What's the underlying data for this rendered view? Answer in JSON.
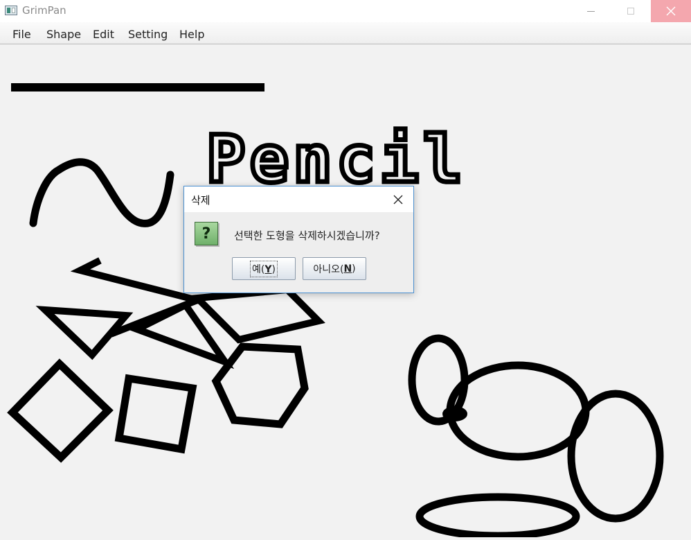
{
  "window": {
    "title": "GrimPan",
    "minimize_icon": "minimize-icon",
    "maximize_icon": "maximize-icon",
    "close_icon": "close-icon"
  },
  "menu": {
    "items": [
      "File",
      "Shape",
      "Edit",
      "Setting",
      "Help"
    ]
  },
  "canvas": {
    "drawn_text": "Pencil",
    "shapes": [
      "line",
      "curve",
      "pencil-text",
      "polyline",
      "triangle",
      "triangle",
      "diamond",
      "square",
      "hexagon",
      "ellipse",
      "ellipse",
      "ellipse",
      "ellipse"
    ]
  },
  "dialog": {
    "title": "삭제",
    "message": "선택한 도형을 삭제하시겠습니까?",
    "icon": "question-icon",
    "icon_glyph": "?",
    "yes": {
      "label": "예(",
      "mnemonic": "Y",
      "suffix": ")"
    },
    "no": {
      "label": "아니오(",
      "mnemonic": "N",
      "suffix": ")"
    }
  },
  "colors": {
    "stroke": "#000000",
    "close_hover": "#f4a7ae",
    "dialog_border": "#4a8fd0"
  }
}
